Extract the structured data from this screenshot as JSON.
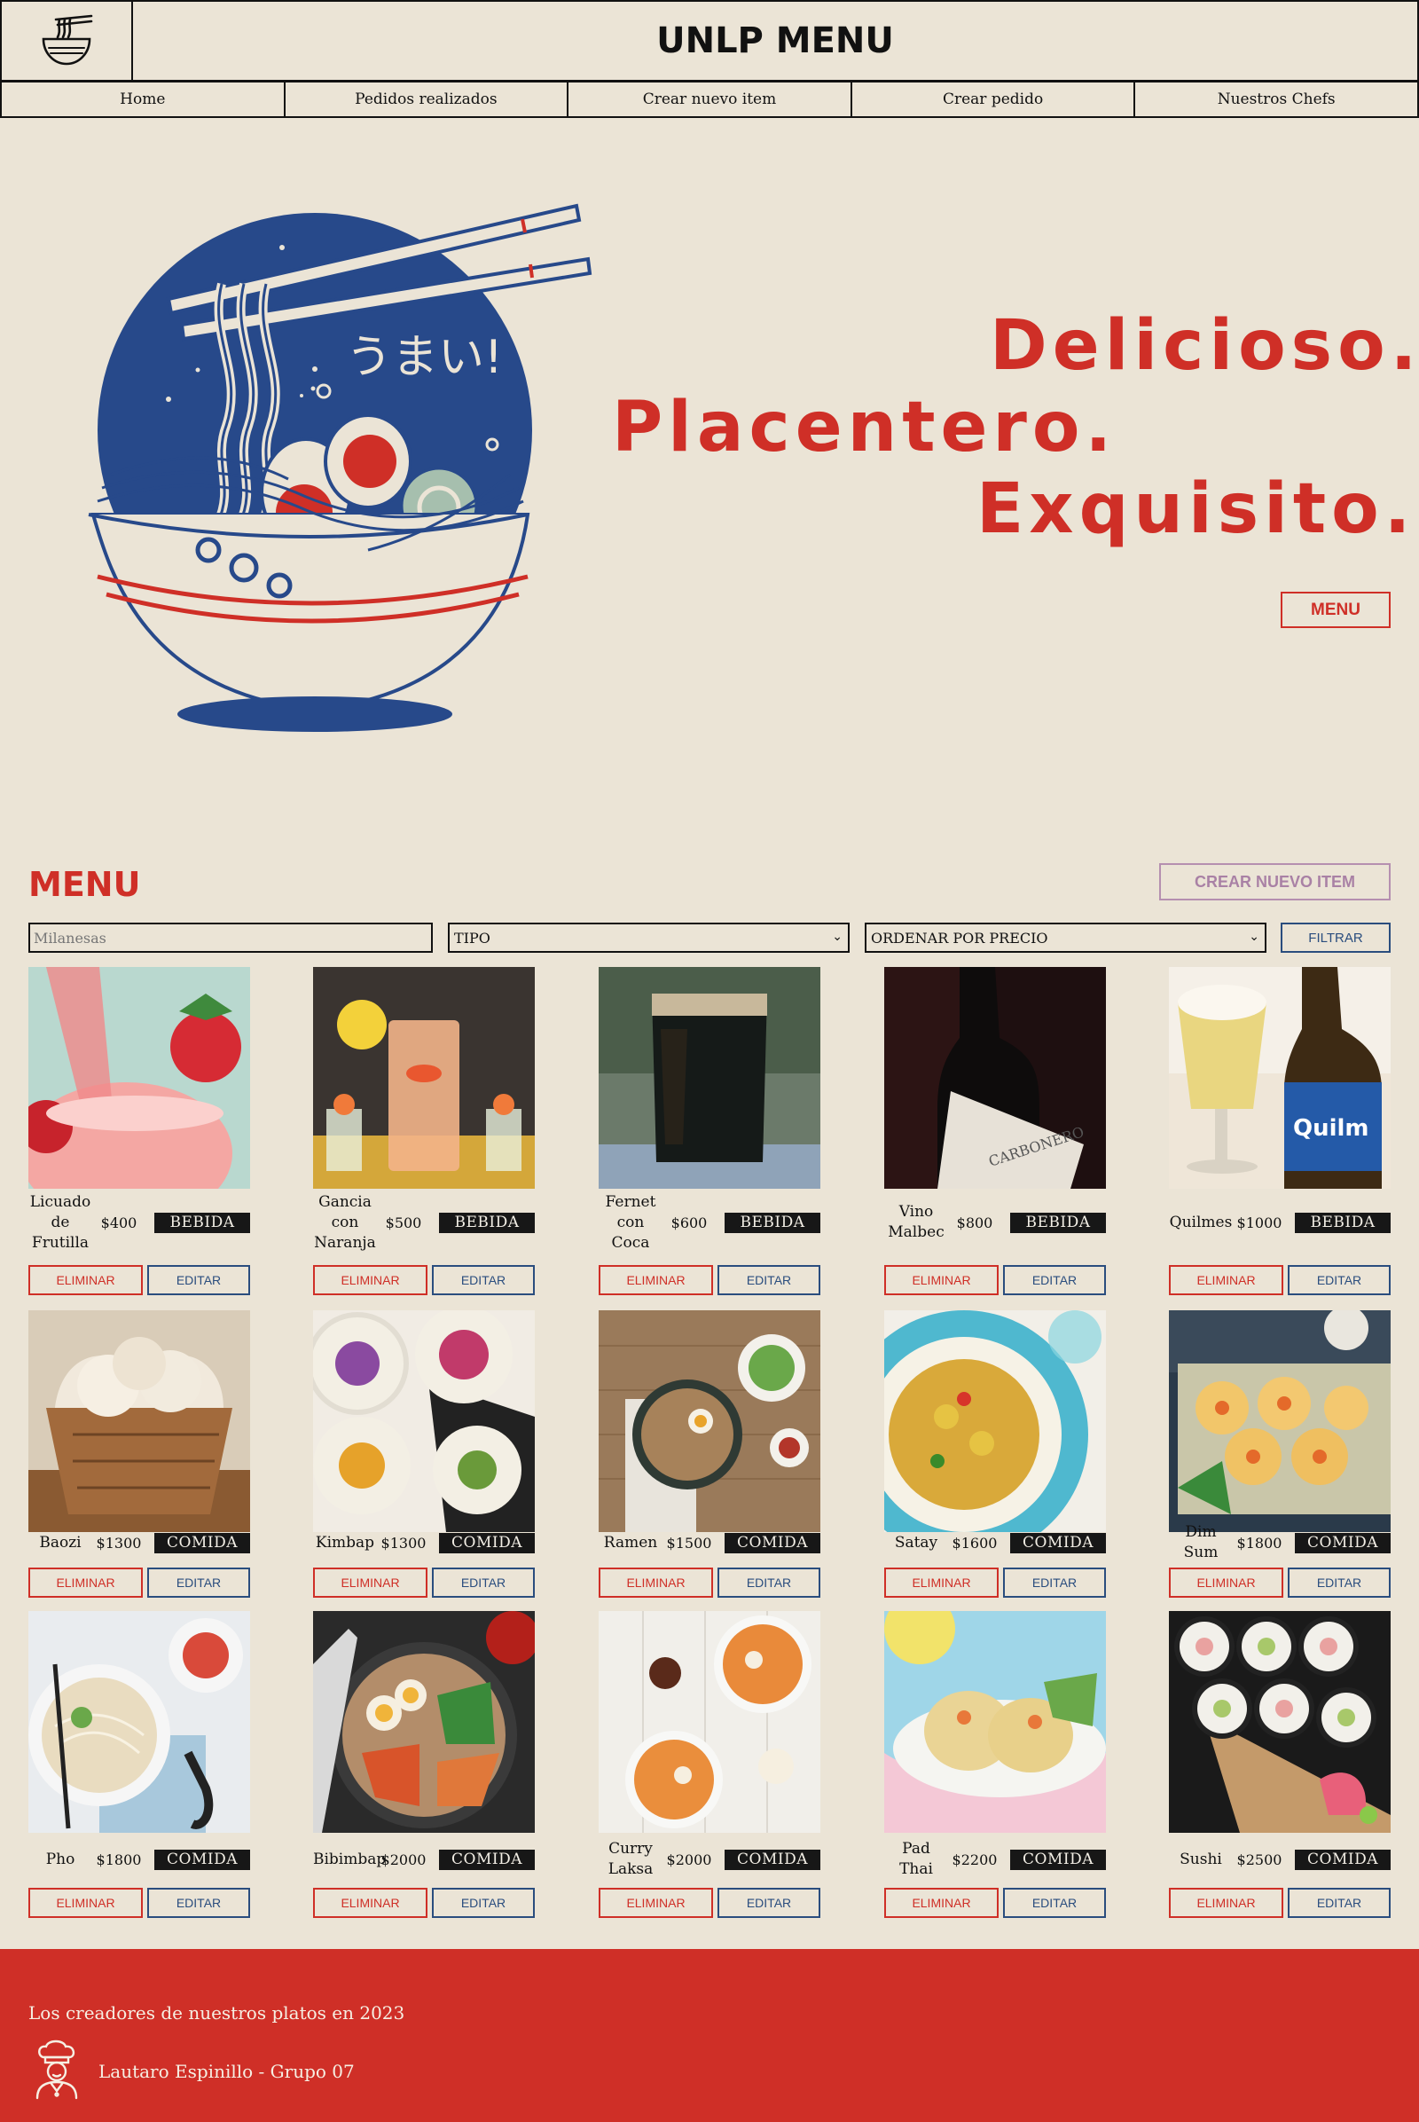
{
  "header": {
    "title": "UNLP MENU",
    "logo_icon": "ramen-bowl-icon"
  },
  "nav": {
    "items": [
      "Home",
      "Pedidos realizados",
      "Crear nuevo item",
      "Crear pedido",
      "Nuestros Chefs"
    ]
  },
  "hero": {
    "illustration_text": "うまい!",
    "tagline_1": "Delicioso.",
    "tagline_2": "Placentero.",
    "tagline_3": "Exquisito.",
    "menu_button": "MENU"
  },
  "menu": {
    "heading": "MENU",
    "create_button": "CREAR NUEVO ITEM",
    "search_placeholder": "Milanesas",
    "type_select": "TIPO",
    "order_select": "ORDENAR POR PRECIO",
    "filter_button": "FILTRAR",
    "delete_label": "ELIMINAR",
    "edit_label": "EDITAR",
    "items": [
      {
        "name": "Licuado de Frutilla",
        "price": "$400",
        "type": "BEBIDA",
        "image": "strawberry-smoothie"
      },
      {
        "name": "Gancia con Naranja",
        "price": "$500",
        "type": "BEBIDA",
        "image": "gancia-orange-drink"
      },
      {
        "name": "Fernet con Coca",
        "price": "$600",
        "type": "BEBIDA",
        "image": "fernet-glass"
      },
      {
        "name": "Vino Malbec",
        "price": "$800",
        "type": "BEBIDA",
        "image": "wine-bottle"
      },
      {
        "name": "Quilmes",
        "price": "$1000",
        "type": "BEBIDA",
        "image": "beer-bottle"
      },
      {
        "name": "Baozi",
        "price": "$1300",
        "type": "COMIDA",
        "image": "baozi-basket"
      },
      {
        "name": "Kimbap",
        "price": "$1300",
        "type": "COMIDA",
        "image": "kimbap-rolls"
      },
      {
        "name": "Ramen",
        "price": "$1500",
        "type": "COMIDA",
        "image": "ramen-bowl"
      },
      {
        "name": "Satay",
        "price": "$1600",
        "type": "COMIDA",
        "image": "satay-curry"
      },
      {
        "name": "Dim Sum",
        "price": "$1800",
        "type": "COMIDA",
        "image": "dim-sum-plate"
      },
      {
        "name": "Pho",
        "price": "$1800",
        "type": "COMIDA",
        "image": "pho-bowl"
      },
      {
        "name": "Bibimbap",
        "price": "$2000",
        "type": "COMIDA",
        "image": "bibimbap-bowl"
      },
      {
        "name": "Curry Laksa",
        "price": "$2000",
        "type": "COMIDA",
        "image": "curry-laksa-bowls"
      },
      {
        "name": "Pad Thai",
        "price": "$2200",
        "type": "COMIDA",
        "image": "pad-thai-plate"
      },
      {
        "name": "Sushi",
        "price": "$2500",
        "type": "COMIDA",
        "image": "sushi-rolls"
      }
    ]
  },
  "footer": {
    "title": "Los creadores de nuestros platos en 2023",
    "author": "Lautaro Espinillo - Grupo 07",
    "icon": "chef-icon"
  },
  "colors": {
    "background": "#ebe4d6",
    "accent_red": "#cf2f27",
    "accent_blue": "#2a4d7e",
    "accent_purple": "#b58fb0",
    "dark": "#171717"
  }
}
